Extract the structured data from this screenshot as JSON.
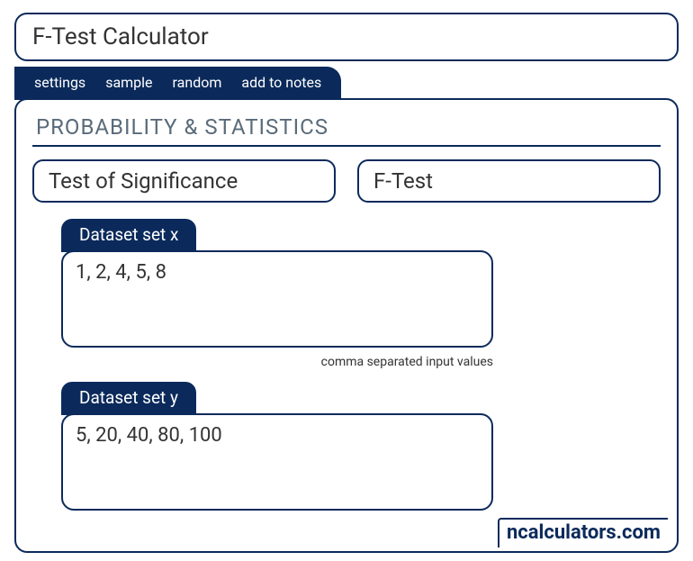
{
  "title": "F-Test Calculator",
  "tabs": {
    "settings": "settings",
    "sample": "sample",
    "random": "random",
    "notes": "add to notes"
  },
  "section": "PROBABILITY & STATISTICS",
  "selects": {
    "category": "Test of Significance",
    "test": "F-Test"
  },
  "datasets": {
    "x": {
      "label": "Dataset set x",
      "value": "1, 2, 4, 5, 8",
      "hint": "comma separated input values"
    },
    "y": {
      "label": "Dataset set y",
      "value": "5, 20, 40, 80, 100"
    }
  },
  "watermark": "ncalculators.com"
}
